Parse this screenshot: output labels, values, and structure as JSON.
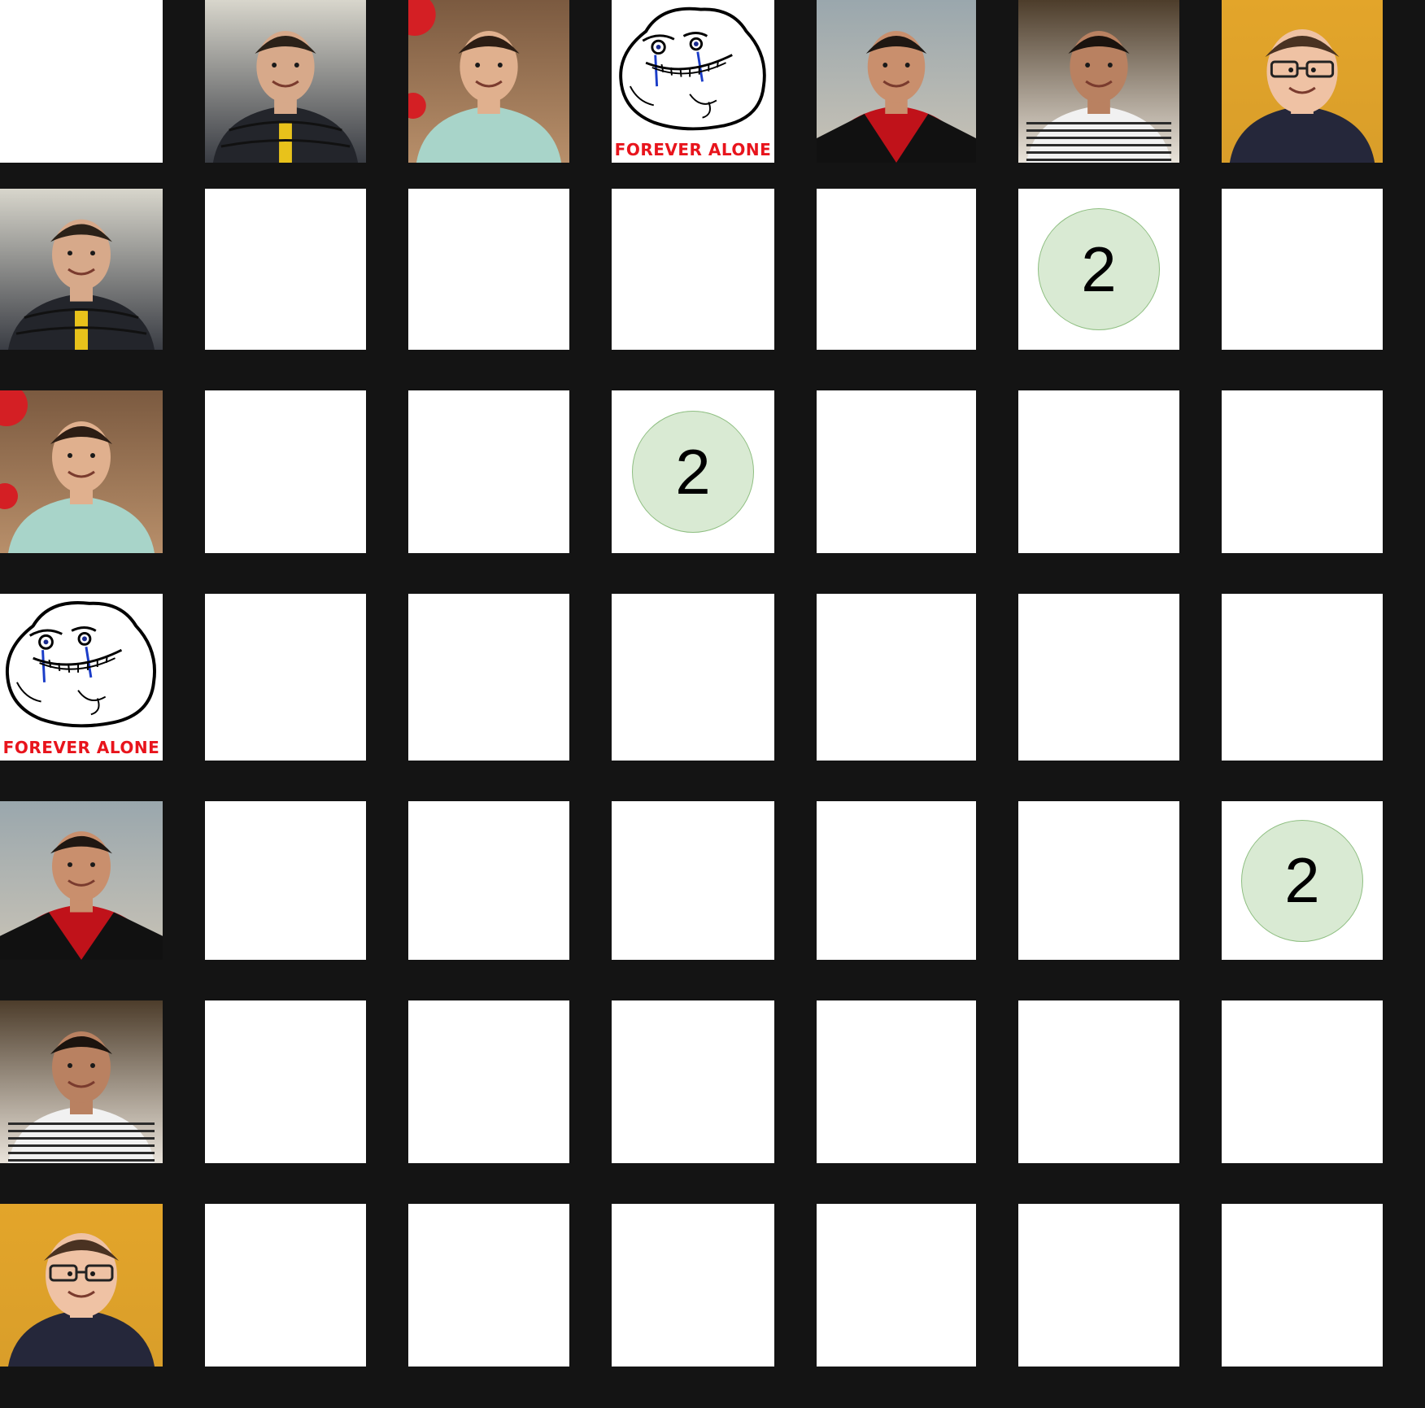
{
  "people": [
    {
      "id": "p1",
      "kind": "photo",
      "bg_top": "#d8d6cc",
      "bg_bottom": "#3a3d44",
      "skin": "#d7a98a",
      "hair": "#2b2118",
      "shirt": "#23252b",
      "accent": "#e8c21b"
    },
    {
      "id": "p2",
      "kind": "photo",
      "bg_top": "#7b5a40",
      "bg_bottom": "#b88f6a",
      "skin": "#e0b08e",
      "hair": "#2c1d14",
      "shirt": "#a8d4c9",
      "accent": "#d41f24"
    },
    {
      "id": "p3",
      "kind": "meme",
      "caption": "FOREVER ALONE"
    },
    {
      "id": "p4",
      "kind": "photo",
      "bg_top": "#9aa7ad",
      "bg_bottom": "#c9c3b6",
      "skin": "#c98f6d",
      "hair": "#1f1712",
      "shirt": "#c0121a",
      "accent": "#111111"
    },
    {
      "id": "p5",
      "kind": "photo",
      "bg_top": "#4d3d2b",
      "bg_bottom": "#e9e3da",
      "skin": "#b98161",
      "hair": "#1b130e",
      "shirt": "#f1f1f1",
      "accent": "#2b2b2b"
    },
    {
      "id": "p6",
      "kind": "photo",
      "bg_top": "#e3a52a",
      "bg_bottom": "#d99e2a",
      "skin": "#efc2a4",
      "hair": "#4a3222",
      "shirt": "#25273a",
      "accent": "#222222"
    }
  ],
  "marks": [
    {
      "row": 0,
      "col": 4,
      "value": "2"
    },
    {
      "row": 1,
      "col": 2,
      "value": "2"
    },
    {
      "row": 3,
      "col": 5,
      "value": "2"
    }
  ],
  "colors": {
    "grid": "#141414",
    "cell": "#ffffff",
    "badge_fill": "#d9ead3",
    "badge_border": "#8fbf82",
    "meme_text": "#e8141c"
  }
}
